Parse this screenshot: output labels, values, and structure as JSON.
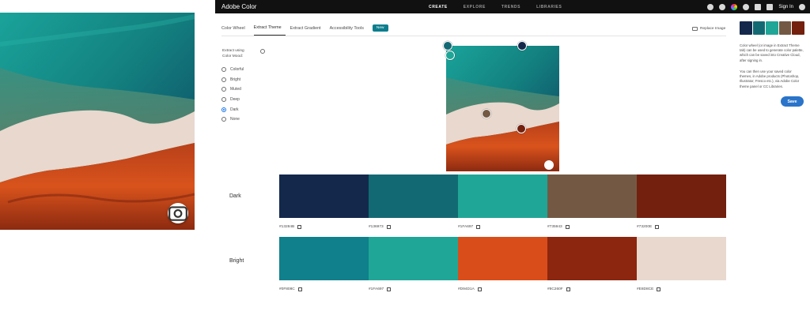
{
  "app": {
    "title": "Adobe Color"
  },
  "nav": [
    {
      "label": "CREATE",
      "active": true
    },
    {
      "label": "EXPLORE",
      "active": false
    },
    {
      "label": "TRENDS",
      "active": false
    },
    {
      "label": "LIBRARIES",
      "active": false
    }
  ],
  "header_right": {
    "sign_in": "Sign In"
  },
  "tabs": [
    {
      "label": "Color Wheel",
      "active": false
    },
    {
      "label": "Extract Theme",
      "active": true
    },
    {
      "label": "Extract Gradient",
      "active": false
    },
    {
      "label": "Accessibility Tools",
      "active": false
    }
  ],
  "new_badge": "New",
  "replace_image": "Replace Image",
  "mood": {
    "label": "Extract using Color Mood:",
    "options": [
      "Colorful",
      "Bright",
      "Muted",
      "Deep",
      "Dark",
      "None"
    ],
    "selected": "Dark"
  },
  "themes": [
    {
      "name": "Dark",
      "colors": [
        "#13284B",
        "#136973",
        "#1FA697",
        "#735943",
        "#73200E"
      ],
      "hex_labels": [
        "#13284B",
        "#136973",
        "#1FA697",
        "#735943",
        "#73200E"
      ]
    },
    {
      "name": "Bright",
      "colors": [
        "#0F808C",
        "#1FA697",
        "#D94D1A",
        "#8C260F",
        "#E8D8CE"
      ],
      "hex_labels": [
        "#0F808C",
        "#1FA697",
        "#D94D1A",
        "#8C260F",
        "#E8D8CE"
      ]
    }
  ],
  "side_panel": {
    "palette": [
      "#13284B",
      "#136973",
      "#1FA697",
      "#735943",
      "#73200E"
    ],
    "text1": "Color wheel (or image in Extract Theme tab) can be used to generate color palette, which can be saved into Creative Cloud, after signing in.",
    "text2": "You can then use your saved color themes, in Adobe products (Photoshop, Illustrator, Fresco etc.), via Adobe Color theme panel or CC Libraries.",
    "save_label": "Save"
  },
  "pickers": [
    "#136973",
    "#1FA697",
    "#13284B",
    "#735943",
    "#73200E"
  ]
}
